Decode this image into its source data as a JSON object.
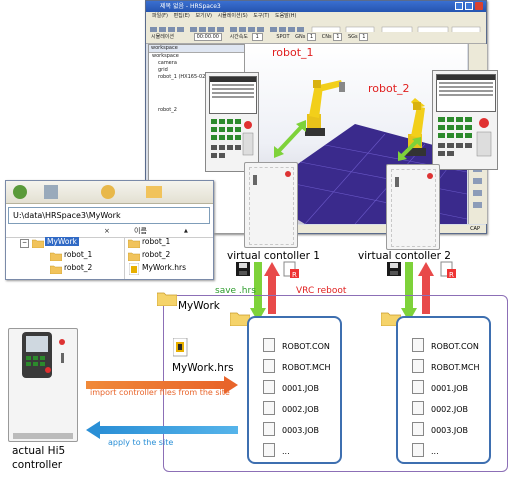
{
  "simulator": {
    "title": "제목 없음 - HRSpace3",
    "menu": [
      "파일(F)",
      "편집(E)",
      "보기(V)",
      "시뮬레이션(S)",
      "도구(T)",
      "도움말(H)"
    ],
    "toolbar_text": [
      "시뮬레이션",
      "00:00.00",
      "시간속도",
      "1",
      "SPOT",
      "GNs",
      "1",
      "CNs",
      "1",
      "SGs",
      "1"
    ],
    "tree_header": "workspace",
    "tree_items": [
      "workspace",
      "camera",
      "grid",
      "robot_1 (HX165-02)",
      "robot_2"
    ],
    "status": "CAP",
    "robot1_label": "robot_1",
    "robot2_label": "robot_2"
  },
  "explorer": {
    "address": "U:\\data\\HRSpace3\\MyWork",
    "column_close": "×",
    "column_name": "이름",
    "tree": {
      "folder": "MyWork",
      "children": [
        "robot_1",
        "robot_2"
      ]
    },
    "files": [
      "robot_1",
      "robot_2",
      "MyWork.hrs"
    ]
  },
  "virtual_controllers": [
    {
      "label": "virtual contoller 1"
    },
    {
      "label": "virtual contoller 2"
    }
  ],
  "arrows": {
    "save": "save .hrs",
    "vrc_reboot": "VRC reboot",
    "import": "import controller files from the site",
    "apply": "apply to the site"
  },
  "mywork": {
    "folder_label": "MyWork",
    "hrs_label": "MyWork.hrs",
    "robots": [
      {
        "name": "robot_1",
        "files": [
          "ROBOT.CON",
          "ROBOT.MCH",
          "0001.JOB",
          "0002.JOB",
          "0003.JOB",
          "..."
        ]
      },
      {
        "name": "robot_2",
        "files": [
          "ROBOT.CON",
          "ROBOT.MCH",
          "0001.JOB",
          "0002.JOB",
          "0003.JOB",
          "..."
        ]
      }
    ]
  },
  "actual": {
    "label_line1": "actual Hi5",
    "label_line2": "controller"
  },
  "colors": {
    "import_arrow": "#e8642a",
    "apply_arrow": "#2a8fd6",
    "save_arrow": "#7ed23a",
    "reboot_arrow": "#e84a4a",
    "robot_label": "#e02020",
    "robot_frame": "#3e6fb0",
    "mywork_frame": "#8c6fb6",
    "floor": "#3a2a8c"
  }
}
